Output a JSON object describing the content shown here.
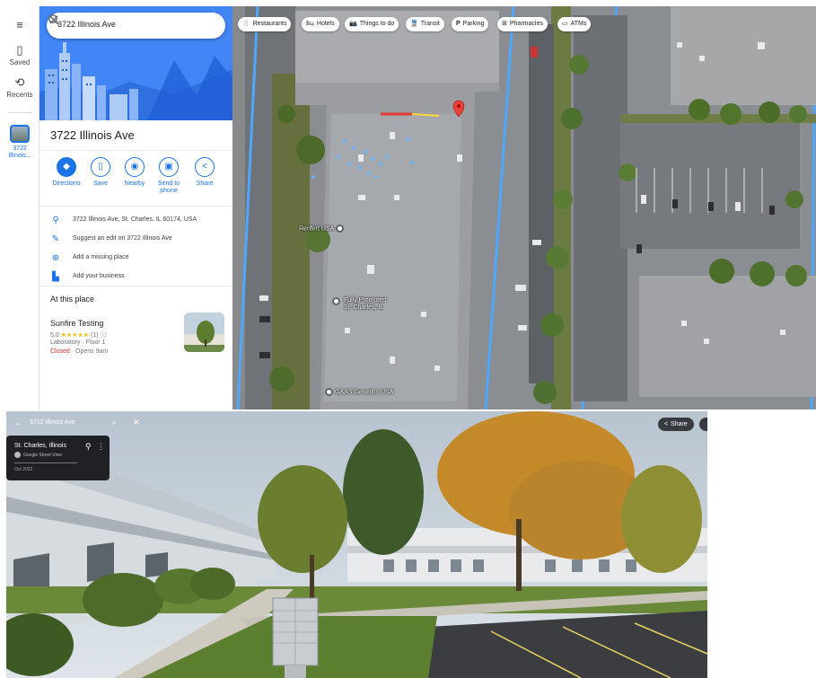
{
  "maps": {
    "rail": {
      "menu_icon": "hamburger-icon",
      "saved_label": "Saved",
      "recents_label": "Recents",
      "place_label_line1": "3722",
      "place_label_line2": "Illinois..."
    },
    "search": {
      "query": "3722 Illinois Ave",
      "search_icon": "search-icon",
      "close_icon": "close-icon"
    },
    "place": {
      "title": "3722 Illinois Ave",
      "actions": [
        {
          "label": "Directions",
          "icon": "directions-icon"
        },
        {
          "label": "Save",
          "icon": "bookmark-icon"
        },
        {
          "label": "Nearby",
          "icon": "nearby-icon"
        },
        {
          "label": "Send to phone",
          "label_line1": "Send to",
          "label_line2": "phone",
          "icon": "send-to-phone-icon"
        },
        {
          "label": "Share",
          "icon": "share-icon"
        }
      ],
      "info_rows": [
        {
          "icon": "location-pin-icon",
          "text": "3722 Illinois Ave, St. Charles, IL 60174, USA"
        },
        {
          "icon": "pencil-icon",
          "text": "Suggest an edit on 3722 Illinois Ave"
        },
        {
          "icon": "add-place-icon",
          "text": "Add a missing place"
        },
        {
          "icon": "business-icon",
          "text": "Add your business"
        }
      ],
      "at_this_place": "At this place",
      "business": {
        "name": "Sunfire Testing",
        "rating": "5.0",
        "stars": "★★★★★",
        "review_count": "(1)",
        "type": "Laboratory · Floor 1",
        "status": "Closed",
        "opens": " · Opens 9am"
      }
    },
    "chips": [
      {
        "icon": "restaurant-icon",
        "glyph": "🍴",
        "label": "Restaurants"
      },
      {
        "icon": "hotel-icon",
        "glyph": "🛏",
        "label": "Hotels"
      },
      {
        "icon": "camera-icon",
        "glyph": "📷",
        "label": "Things to do"
      },
      {
        "icon": "transit-icon",
        "glyph": "🚆",
        "label": "Transit"
      },
      {
        "icon": "parking-icon",
        "glyph": "P",
        "label": "Parking"
      },
      {
        "icon": "pharmacy-icon",
        "glyph": "⊞",
        "label": "Pharmacies"
      },
      {
        "icon": "atm-icon",
        "glyph": "▭",
        "label": "ATMs"
      }
    ],
    "map_labels": {
      "renfert": "Renfert USA",
      "promoted_line1": "Fully Promoted",
      "promoted_line2": "St. Charles, IL",
      "genetics": "GAAS Genetics USA"
    },
    "colors": {
      "accent": "#1a73e8",
      "pin": "#ea4335",
      "closed": "#d93025",
      "stars": "#fbbc04"
    }
  },
  "street_view": {
    "back_icon": "back-arrow-icon",
    "search_text": "3722 Illinois Ave",
    "location": "St. Charles, Illinois",
    "brand": "Google Street View",
    "date": "Oct 2022",
    "share_label": "Share"
  }
}
